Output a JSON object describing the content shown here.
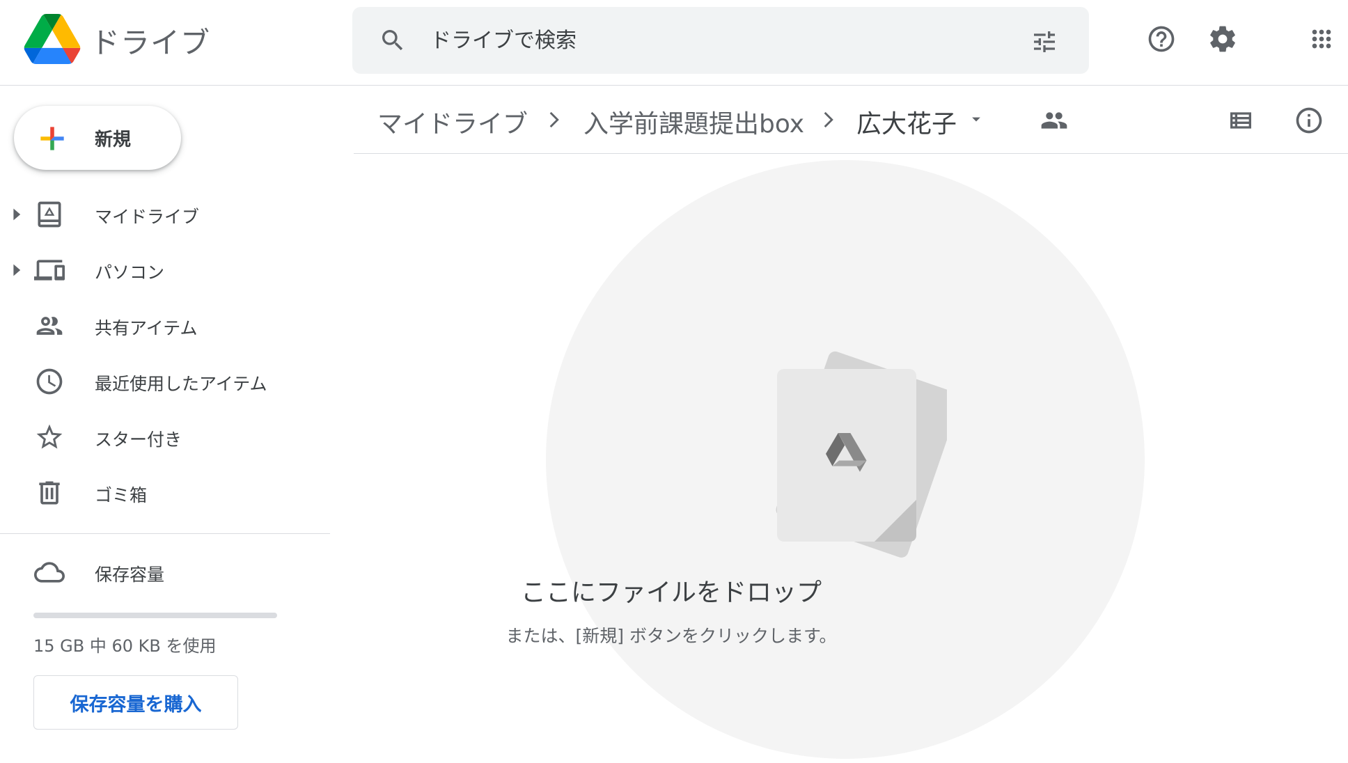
{
  "header": {
    "app_title": "ドライブ",
    "search_placeholder": "ドライブで検索"
  },
  "sidebar": {
    "new_label": "新規",
    "items": [
      {
        "label": "マイドライブ",
        "icon": "my-drive-icon",
        "expandable": true
      },
      {
        "label": "パソコン",
        "icon": "computers-icon",
        "expandable": true
      },
      {
        "label": "共有アイテム",
        "icon": "shared-people-icon",
        "expandable": false
      },
      {
        "label": "最近使用したアイテム",
        "icon": "clock-icon",
        "expandable": false
      },
      {
        "label": "スター付き",
        "icon": "star-icon",
        "expandable": false
      },
      {
        "label": "ゴミ箱",
        "icon": "trash-icon",
        "expandable": false
      }
    ],
    "storage": {
      "label": "保存容量",
      "usage_text": "15 GB 中 60 KB を使用",
      "used_fraction": 4e-06,
      "buy_label": "保存容量を購入"
    }
  },
  "breadcrumb": [
    {
      "label": "マイドライブ"
    },
    {
      "label": "入学前課題提出box"
    },
    {
      "label": "広大花子"
    }
  ],
  "empty_state": {
    "title": "ここにファイルをドロップ",
    "subtitle": "または、[新規] ボタンをクリックします。"
  },
  "colors": {
    "drive_green": "#1e8e3e",
    "drive_yellow": "#fbbc04",
    "drive_blue": "#4285f4",
    "drive_red": "#ea4335",
    "icon_gray": "#5f6368",
    "accent_blue": "#1967d2"
  }
}
